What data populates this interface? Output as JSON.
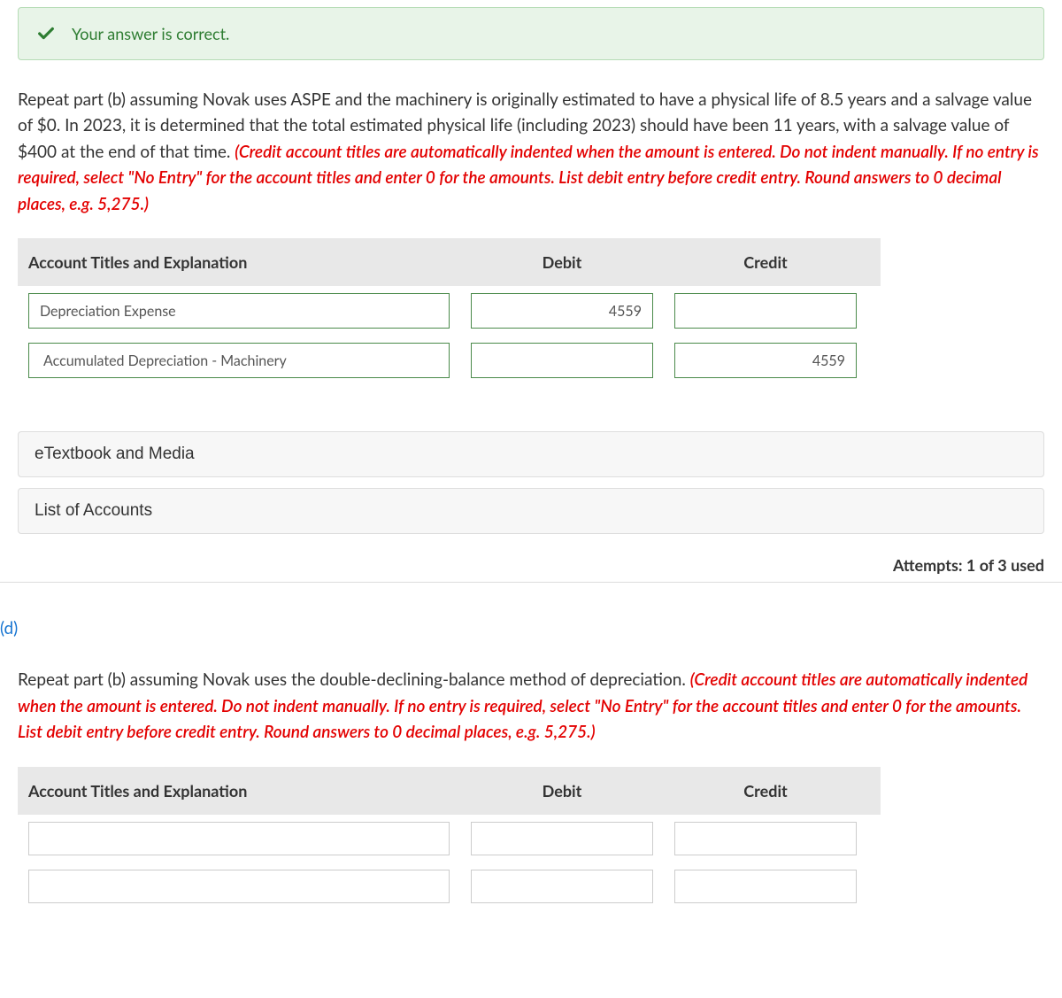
{
  "banner": {
    "text": "Your answer is correct."
  },
  "question_c": {
    "text": "Repeat part (b) assuming Novak uses ASPE and the machinery is originally estimated to have a physical life of 8.5 years and a salvage value of $0. In 2023, it is determined that the total estimated physical life (including 2023) should have been 11 years, with a salvage value of $400 at the end of that time. ",
    "red": "(Credit account titles are automatically indented when the amount is entered. Do not indent manually. If no entry is required, select \"No Entry\" for the account titles and enter 0 for the amounts. List debit entry before credit entry. Round answers to 0 decimal places, e.g. 5,275.)"
  },
  "table_headers": {
    "title": "Account Titles and Explanation",
    "debit": "Debit",
    "credit": "Credit"
  },
  "entries_c": [
    {
      "title": "Depreciation Expense",
      "debit": "4559",
      "credit": ""
    },
    {
      "title": "Accumulated Depreciation - Machinery",
      "debit": "",
      "credit": "4559"
    }
  ],
  "resources": {
    "etextbook": "eTextbook and Media",
    "accounts": "List of Accounts"
  },
  "attempts": "Attempts: 1 of 3 used",
  "part_d_label": "(d)",
  "question_d": {
    "text": "Repeat part (b) assuming Novak uses the double-declining-balance method of depreciation. ",
    "red": "(Credit account titles are automatically indented when the amount is entered. Do not indent manually. If no entry is required, select \"No Entry\" for the account titles and enter 0 for the amounts. List debit entry before credit entry. Round answers to 0 decimal places, e.g. 5,275.)"
  },
  "entries_d": [
    {
      "title": "",
      "debit": "",
      "credit": ""
    },
    {
      "title": "",
      "debit": "",
      "credit": ""
    }
  ]
}
